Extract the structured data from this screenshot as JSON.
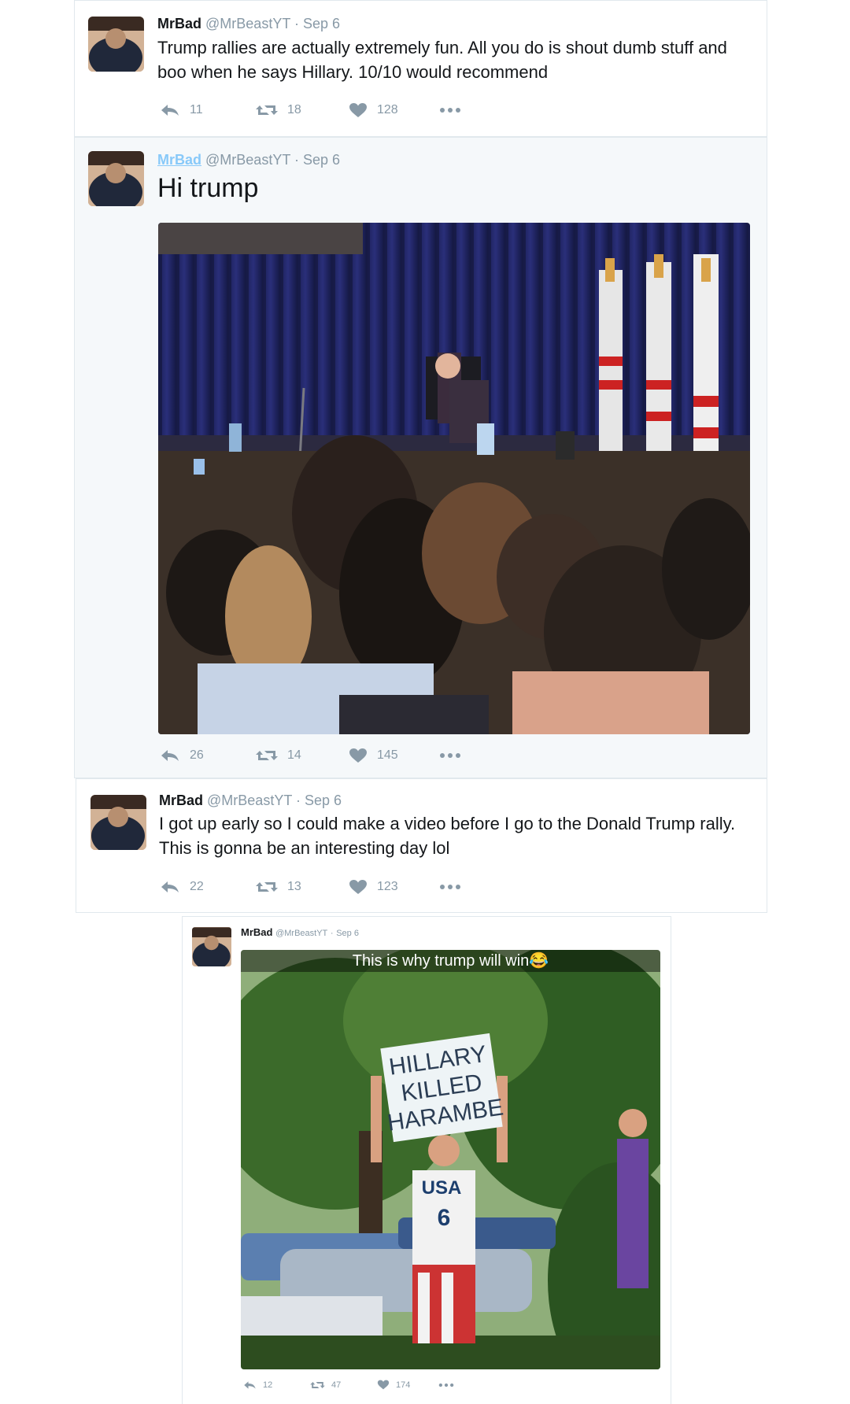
{
  "tweets": [
    {
      "name": "MrBad",
      "handle": "@MrBeastYT",
      "sep": "·",
      "date": "Sep 6",
      "text": "Trump rallies are actually extremely fun. All you do is shout dumb stuff and boo when he says Hillary. 10/10 would recommend",
      "replies": "11",
      "retweets": "18",
      "likes": "128"
    },
    {
      "name": "MrBad",
      "handle": "@MrBeastYT",
      "sep": "·",
      "date": "Sep 6",
      "text": "Hi trump",
      "replies": "26",
      "retweets": "14",
      "likes": "145"
    },
    {
      "name": "MrBad",
      "handle": "@MrBeastYT",
      "sep": "·",
      "date": "Sep 6",
      "text": "I got up early so I could make a video before I go to the Donald Trump rally. This is gonna be an interesting day lol",
      "replies": "22",
      "retweets": "13",
      "likes": "123"
    },
    {
      "name": "MrBad",
      "handle": "@MrBeastYT",
      "sep": "·",
      "date": "Sep 6",
      "caption": "This is why trump will win😂",
      "sign_lines": [
        "HILLARY",
        "KILLED",
        "HARAMBE"
      ],
      "jersey_text": "USA",
      "jersey_number": "6",
      "replies": "12",
      "retweets": "47",
      "likes": "174"
    }
  ],
  "icons": {
    "reply": "reply-icon",
    "retweet": "retweet-icon",
    "like": "heart-icon",
    "more": "more-icon"
  },
  "colors": {
    "link": "#88c9f9",
    "muted": "#8899a6",
    "text": "#14171a",
    "border": "#e1e8ed"
  }
}
